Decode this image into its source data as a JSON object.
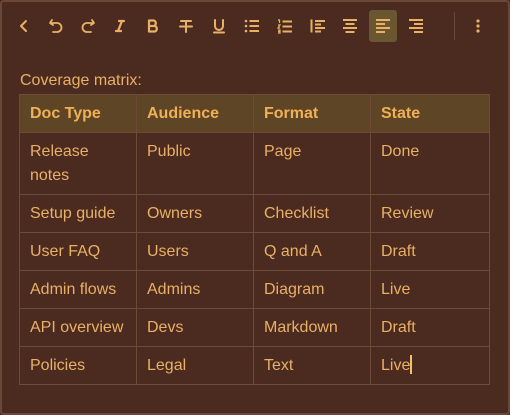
{
  "toolbar": {
    "buttons": [
      {
        "name": "collapse-toolbar-button",
        "icon": "chevron-left-icon"
      },
      {
        "name": "undo-button",
        "icon": "undo-icon"
      },
      {
        "name": "redo-button",
        "icon": "redo-icon"
      },
      {
        "name": "italic-button",
        "icon": "italic-icon"
      },
      {
        "name": "bold-button",
        "icon": "bold-icon"
      },
      {
        "name": "strikethrough-button",
        "icon": "strikethrough-icon"
      },
      {
        "name": "underline-button",
        "icon": "underline-icon"
      },
      {
        "name": "bullet-list-button",
        "icon": "bullet-list-icon"
      },
      {
        "name": "numbered-list-button",
        "icon": "numbered-list-icon"
      },
      {
        "name": "block-quote-button",
        "icon": "indent-left-icon"
      },
      {
        "name": "align-center-button",
        "icon": "align-center-icon"
      },
      {
        "name": "align-left-button",
        "icon": "align-left-icon",
        "active": true
      },
      {
        "name": "align-right-button",
        "icon": "align-right-icon"
      },
      {
        "name": "more-options-button",
        "icon": "more-vertical-icon"
      }
    ]
  },
  "content": {
    "label": "Coverage matrix:",
    "table": {
      "headers": [
        "Doc Type",
        "Audience",
        "Format",
        "State"
      ],
      "rows": [
        [
          "Release notes",
          "Public",
          "Page",
          "Done"
        ],
        [
          "Setup guide",
          "Owners",
          "Checklist",
          "Review"
        ],
        [
          "User FAQ",
          "Users",
          "Q and A",
          "Draft"
        ],
        [
          "Admin flows",
          "Admins",
          "Diagram",
          "Live"
        ],
        [
          "API overview",
          "Devs",
          "Markdown",
          "Draft"
        ],
        [
          "Policies",
          "Legal",
          "Text",
          "Live"
        ]
      ]
    }
  },
  "colors": {
    "background": "#4b2a20",
    "text": "#e9b066",
    "header_bg": "#5e4525",
    "active_button_bg": "#6b5632",
    "border": "#6e4a38"
  }
}
